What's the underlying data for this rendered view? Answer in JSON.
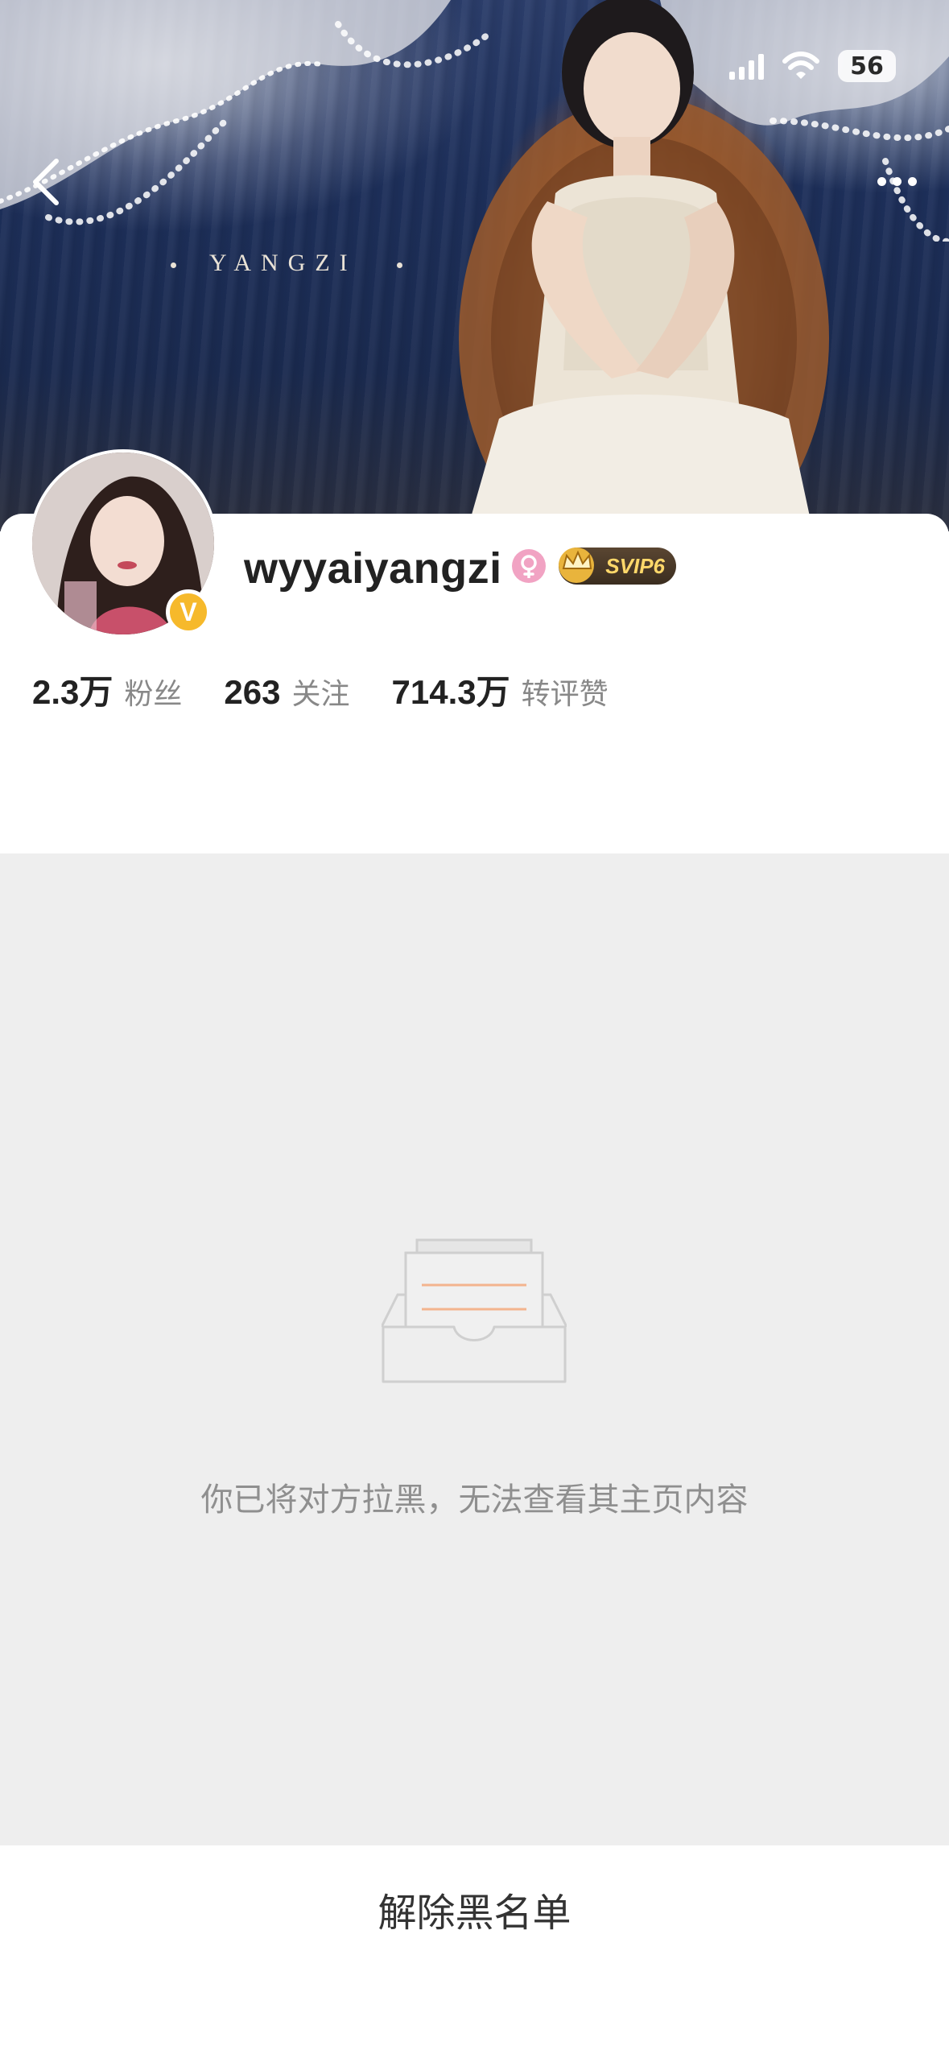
{
  "status_bar": {
    "battery": "56"
  },
  "cover": {
    "title": "YANGZI"
  },
  "profile": {
    "username": "wyyaiyangzi",
    "vip_badge": "SVIP6",
    "verified_badge": "V",
    "gender_icon": "female-icon",
    "stats": [
      {
        "value": "2.3万",
        "label": "粉丝"
      },
      {
        "value": "263",
        "label": "关注"
      },
      {
        "value": "714.3万",
        "label": "转评赞"
      }
    ]
  },
  "empty_state": {
    "message": "你已将对方拉黑，无法查看其主页内容"
  },
  "bottom_action": {
    "label": "解除黑名单"
  },
  "colors": {
    "badge_gold": "#f6b92b",
    "gender_pink": "#f1a3c3",
    "empty_bg": "#eeeeee"
  }
}
